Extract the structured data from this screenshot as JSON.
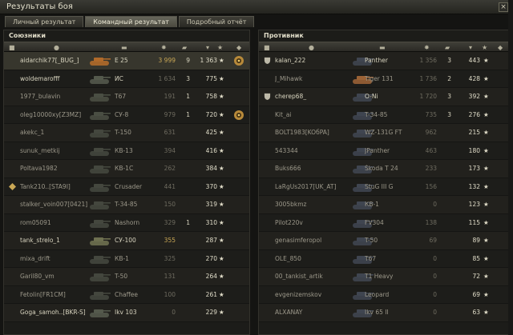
{
  "window": {
    "title": "Результаты боя",
    "close_label": "×"
  },
  "tabs": [
    {
      "label": "Личный результат",
      "active": false
    },
    {
      "label": "Командный результат",
      "active": true
    },
    {
      "label": "Подробный отчёт",
      "active": false
    }
  ],
  "allies": {
    "title": "Союзники",
    "rows": [
      {
        "name": "aidarchik77[_BUG_]",
        "tank": "E 25",
        "damage": "3 999",
        "kills": "9",
        "xp": "1 363",
        "alive": true,
        "me": true,
        "medal": "gear-medal-icon",
        "tank_color": "#b06a2a"
      },
      {
        "name": "woldemarofff",
        "tank": "ИС",
        "damage": "1 634",
        "kills": "3",
        "xp": "775",
        "alive": true,
        "tank_color": "#54594c"
      },
      {
        "name": "1977_bulavin",
        "tank": "T67",
        "damage": "191",
        "kills": "1",
        "xp": "758",
        "alive": false,
        "tank_color": "#4a4e43"
      },
      {
        "name": "oleg10000xy[Z3MZ]",
        "tank": "СУ-8",
        "damage": "979",
        "kills": "1",
        "xp": "720",
        "alive": false,
        "medal": "gear-medal-icon",
        "tank_color": "#4a4e43"
      },
      {
        "name": "akekc_1",
        "tank": "T-150",
        "damage": "631",
        "kills": "",
        "xp": "425",
        "alive": false,
        "tank_color": "#44473e"
      },
      {
        "name": "sunuk_metkij",
        "tank": "КВ-13",
        "damage": "394",
        "kills": "",
        "xp": "416",
        "alive": false,
        "tank_color": "#44473e"
      },
      {
        "name": "Poltava1982",
        "tank": "КВ-1С",
        "damage": "262",
        "kills": "",
        "xp": "384",
        "alive": false,
        "tank_color": "#44473e"
      },
      {
        "name": "Tank210..[STA9I]",
        "tank": "Crusader",
        "damage": "441",
        "kills": "",
        "xp": "370",
        "alive": false,
        "badge": "clan-diamond-icon",
        "tank_color": "#44473e"
      },
      {
        "name": "stalker_voin007[0421]",
        "tank": "T-34-85",
        "damage": "150",
        "kills": "",
        "xp": "319",
        "alive": false,
        "tank_color": "#44473e"
      },
      {
        "name": "rom05091",
        "tank": "Nashorn",
        "damage": "329",
        "kills": "1",
        "xp": "310",
        "alive": false,
        "tank_color": "#44473e"
      },
      {
        "name": "tank_strelo_1",
        "tank": "СУ-100",
        "damage": "355",
        "kills": "",
        "xp": "287",
        "alive": true,
        "dmg_hi": true,
        "tank_color": "#6e7050"
      },
      {
        "name": "mixa_drift",
        "tank": "КВ-1",
        "damage": "325",
        "kills": "",
        "xp": "270",
        "alive": false,
        "tank_color": "#44473e"
      },
      {
        "name": "Garil80_vm",
        "tank": "T-50",
        "damage": "131",
        "kills": "",
        "xp": "264",
        "alive": false,
        "tank_color": "#44473e"
      },
      {
        "name": "Fetolin[FR1CM]",
        "tank": "Chaffee",
        "damage": "100",
        "kills": "",
        "xp": "261",
        "alive": false,
        "tank_color": "#44473e"
      },
      {
        "name": "Goga_samoh..[BKR-S]",
        "tank": "Ikv 103",
        "damage": "0",
        "kills": "",
        "xp": "229",
        "alive": true,
        "tank_color": "#54594c"
      }
    ]
  },
  "enemies": {
    "title": "Противник",
    "rows": [
      {
        "name": "kalan_222",
        "tank": "Panther",
        "damage": "1 356",
        "kills": "3",
        "xp": "443",
        "alive": true,
        "badge": "shield-icon",
        "tank_color": "#3f4550"
      },
      {
        "name": "J_Mihawk",
        "tank": "Tiger 131",
        "damage": "1 736",
        "kills": "2",
        "xp": "428",
        "alive": false,
        "tank_color": "#9a6236"
      },
      {
        "name": "cherep68_",
        "tank": "O-Ni",
        "damage": "1 720",
        "kills": "3",
        "xp": "392",
        "alive": true,
        "badge": "shield-icon",
        "tank_color": "#3f4550"
      },
      {
        "name": "Kit_ai",
        "tank": "T-34-85",
        "damage": "735",
        "kills": "3",
        "xp": "276",
        "alive": false,
        "tank_color": "#3f4550"
      },
      {
        "name": "BOLT1983[KOбPA]",
        "tank": "WZ-131G FT",
        "damage": "962",
        "kills": "",
        "xp": "215",
        "alive": false,
        "tank_color": "#3f4550"
      },
      {
        "name": "543344",
        "tank": "JPanther",
        "damage": "463",
        "kills": "",
        "xp": "180",
        "alive": false,
        "tank_color": "#3f4550"
      },
      {
        "name": "Buks666",
        "tank": "Škoda T 24",
        "damage": "233",
        "kills": "",
        "xp": "173",
        "alive": false,
        "tank_color": "#3f4550"
      },
      {
        "name": "LaRgUs2017[UK_AT]",
        "tank": "StuG III G",
        "damage": "156",
        "kills": "",
        "xp": "132",
        "alive": false,
        "tank_color": "#3f4550"
      },
      {
        "name": "3005bkmz",
        "tank": "КВ-1",
        "damage": "0",
        "kills": "",
        "xp": "123",
        "alive": false,
        "tank_color": "#3f4550"
      },
      {
        "name": "Pilot220v",
        "tank": "FV304",
        "damage": "138",
        "kills": "",
        "xp": "115",
        "alive": false,
        "tank_color": "#3f4550"
      },
      {
        "name": "genasimferopol",
        "tank": "T-50",
        "damage": "69",
        "kills": "",
        "xp": "89",
        "alive": false,
        "tank_color": "#3f4550"
      },
      {
        "name": "OLE_850",
        "tank": "T67",
        "damage": "0",
        "kills": "",
        "xp": "85",
        "alive": false,
        "tank_color": "#3f4550"
      },
      {
        "name": "00_tankist_artik",
        "tank": "T1 Heavy",
        "damage": "0",
        "kills": "",
        "xp": "72",
        "alive": false,
        "tank_color": "#3f4550"
      },
      {
        "name": "evgenizemskov",
        "tank": "Leopard",
        "damage": "0",
        "kills": "",
        "xp": "69",
        "alive": false,
        "tank_color": "#3f4550"
      },
      {
        "name": "ALXANAY",
        "tank": "Ikv 65 II",
        "damage": "0",
        "kills": "",
        "xp": "63",
        "alive": false,
        "tank_color": "#3f4550"
      }
    ]
  },
  "star_glyph": "★",
  "colors": {
    "damage_highlight": "#c9a755",
    "text_alive": "#d8d4bf",
    "text_dead": "#9c988a",
    "row_me": "#37362d"
  }
}
